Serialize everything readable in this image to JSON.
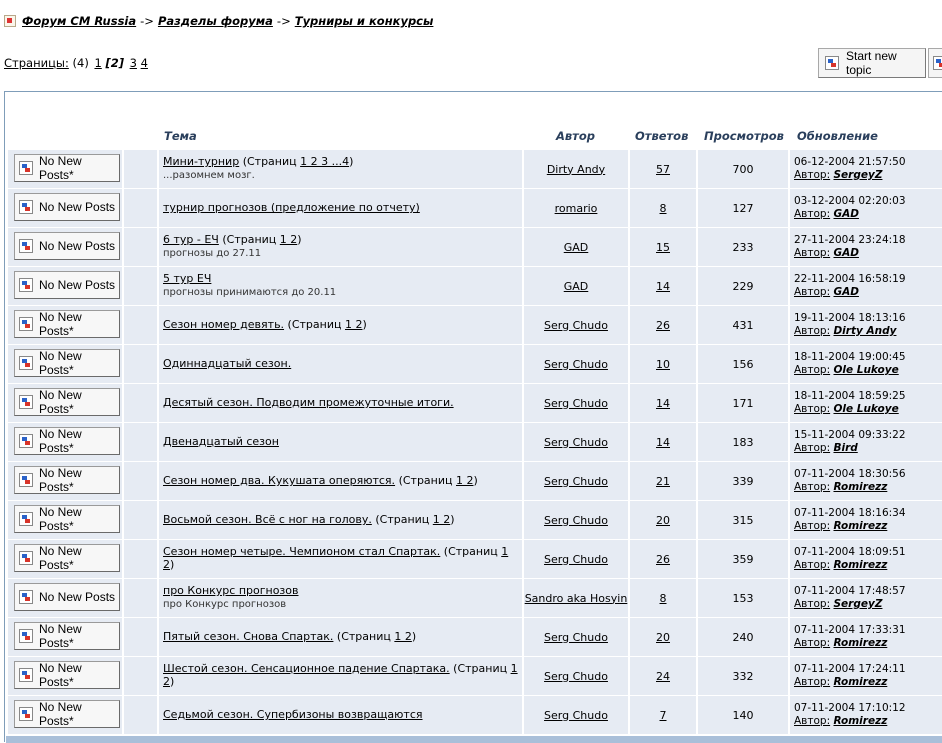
{
  "breadcrumb": {
    "items": [
      "Форум CM Russia",
      "Разделы форума",
      "Турниры и конкурсы"
    ],
    "separator": "->"
  },
  "pagination": {
    "label": "Страницы:",
    "total": "(4)",
    "pages": [
      "1",
      "[2]",
      "3",
      "4"
    ]
  },
  "start_topic_label": "Start new topic",
  "columns": {
    "topic": "Тема",
    "author": "Автор",
    "replies": "Ответов",
    "views": "Просмотров",
    "updated": "Обновление"
  },
  "author_label": "Автор:",
  "topics": [
    {
      "status": "No New Posts*",
      "title": "Мини-турнир",
      "pages_prefix": "(Страниц ",
      "pages": "1 2 3 ...4",
      "pages_suffix": ")",
      "desc": "...разомнем мозг.",
      "author": "Dirty Andy",
      "replies": "57",
      "views": "700",
      "date": "06-12-2004 21:57:50",
      "last_author": "SergeyZ"
    },
    {
      "status": "No New Posts",
      "title": "турнир прогнозов (предложение по отчету)",
      "pages_prefix": "",
      "pages": "",
      "pages_suffix": "",
      "desc": "",
      "author": "romario",
      "replies": "8",
      "views": "127",
      "date": "03-12-2004 02:20:03",
      "last_author": "GAD"
    },
    {
      "status": "No New Posts",
      "title": "6 тур - ЕЧ",
      "pages_prefix": "(Страниц ",
      "pages": "1 2",
      "pages_suffix": ")",
      "desc": "прогнозы до 27.11",
      "author": "GAD",
      "replies": "15",
      "views": "233",
      "date": "27-11-2004 23:24:18",
      "last_author": "GAD"
    },
    {
      "status": "No New Posts",
      "title": "5 тур ЕЧ",
      "pages_prefix": "",
      "pages": "",
      "pages_suffix": "",
      "desc": "прогнозы принимаются до 20.11",
      "author": "GAD",
      "replies": "14",
      "views": "229",
      "date": "22-11-2004 16:58:19",
      "last_author": "GAD"
    },
    {
      "status": "No New Posts*",
      "title": "Сезон номер девять.",
      "pages_prefix": "(Страниц ",
      "pages": "1 2",
      "pages_suffix": ")",
      "desc": "",
      "author": "Serg Chudo",
      "replies": "26",
      "views": "431",
      "date": "19-11-2004 18:13:16",
      "last_author": "Dirty Andy"
    },
    {
      "status": "No New Posts*",
      "title": "Одиннадцатый сезон.",
      "pages_prefix": "",
      "pages": "",
      "pages_suffix": "",
      "desc": "",
      "author": "Serg Chudo",
      "replies": "10",
      "views": "156",
      "date": "18-11-2004 19:00:45",
      "last_author": "Ole Lukoye"
    },
    {
      "status": "No New Posts*",
      "title": "Десятый сезон. Подводим промежуточные итоги.",
      "pages_prefix": "",
      "pages": "",
      "pages_suffix": "",
      "desc": "",
      "author": "Serg Chudo",
      "replies": "14",
      "views": "171",
      "date": "18-11-2004 18:59:25",
      "last_author": "Ole Lukoye"
    },
    {
      "status": "No New Posts*",
      "title": "Двенадцатый сезон",
      "pages_prefix": "",
      "pages": "",
      "pages_suffix": "",
      "desc": "",
      "author": "Serg Chudo",
      "replies": "14",
      "views": "183",
      "date": "15-11-2004 09:33:22",
      "last_author": "Bird"
    },
    {
      "status": "No New Posts*",
      "title": "Сезон номер два. Кукушата оперяются.",
      "pages_prefix": "(Страниц ",
      "pages": "1 2",
      "pages_suffix": ")",
      "desc": "",
      "author": "Serg Chudo",
      "replies": "21",
      "views": "339",
      "date": "07-11-2004 18:30:56",
      "last_author": "Romirezz"
    },
    {
      "status": "No New Posts*",
      "title": "Восьмой сезон. Всё с ног на голову.",
      "pages_prefix": "(Страниц ",
      "pages": "1 2",
      "pages_suffix": ")",
      "desc": "",
      "author": "Serg Chudo",
      "replies": "20",
      "views": "315",
      "date": "07-11-2004 18:16:34",
      "last_author": "Romirezz"
    },
    {
      "status": "No New Posts*",
      "title": "Сезон номер четыре. Чемпионом стал Спартак.",
      "pages_prefix": "(Страниц ",
      "pages": "1 2",
      "pages_suffix": ")",
      "desc": "",
      "author": "Serg Chudo",
      "replies": "26",
      "views": "359",
      "date": "07-11-2004 18:09:51",
      "last_author": "Romirezz"
    },
    {
      "status": "No New Posts",
      "title": "про Конкурс прогнозов",
      "pages_prefix": "",
      "pages": "",
      "pages_suffix": "",
      "desc": "про Конкурс прогнозов",
      "author": "Sandro aka Hosyin",
      "replies": "8",
      "views": "153",
      "date": "07-11-2004 17:48:57",
      "last_author": "SergeyZ"
    },
    {
      "status": "No New Posts*",
      "title": "Пятый сезон. Снова Спартак.",
      "pages_prefix": "(Страниц ",
      "pages": "1 2",
      "pages_suffix": ")",
      "desc": "",
      "author": "Serg Chudo",
      "replies": "20",
      "views": "240",
      "date": "07-11-2004 17:33:31",
      "last_author": "Romirezz"
    },
    {
      "status": "No New Posts*",
      "title": "Шестой сезон. Сенсационное падение Спартака.",
      "pages_prefix": "(Страниц ",
      "pages": "1 2",
      "pages_suffix": ")",
      "desc": "",
      "author": "Serg Chudo",
      "replies": "24",
      "views": "332",
      "date": "07-11-2004 17:24:11",
      "last_author": "Romirezz"
    },
    {
      "status": "No New Posts*",
      "title": "Седьмой сезон. Супербизоны возвращаются",
      "pages_prefix": "",
      "pages": "",
      "pages_suffix": "",
      "desc": "",
      "author": "Serg Chudo",
      "replies": "7",
      "views": "140",
      "date": "07-11-2004 17:10:12",
      "last_author": "Romirezz"
    }
  ]
}
